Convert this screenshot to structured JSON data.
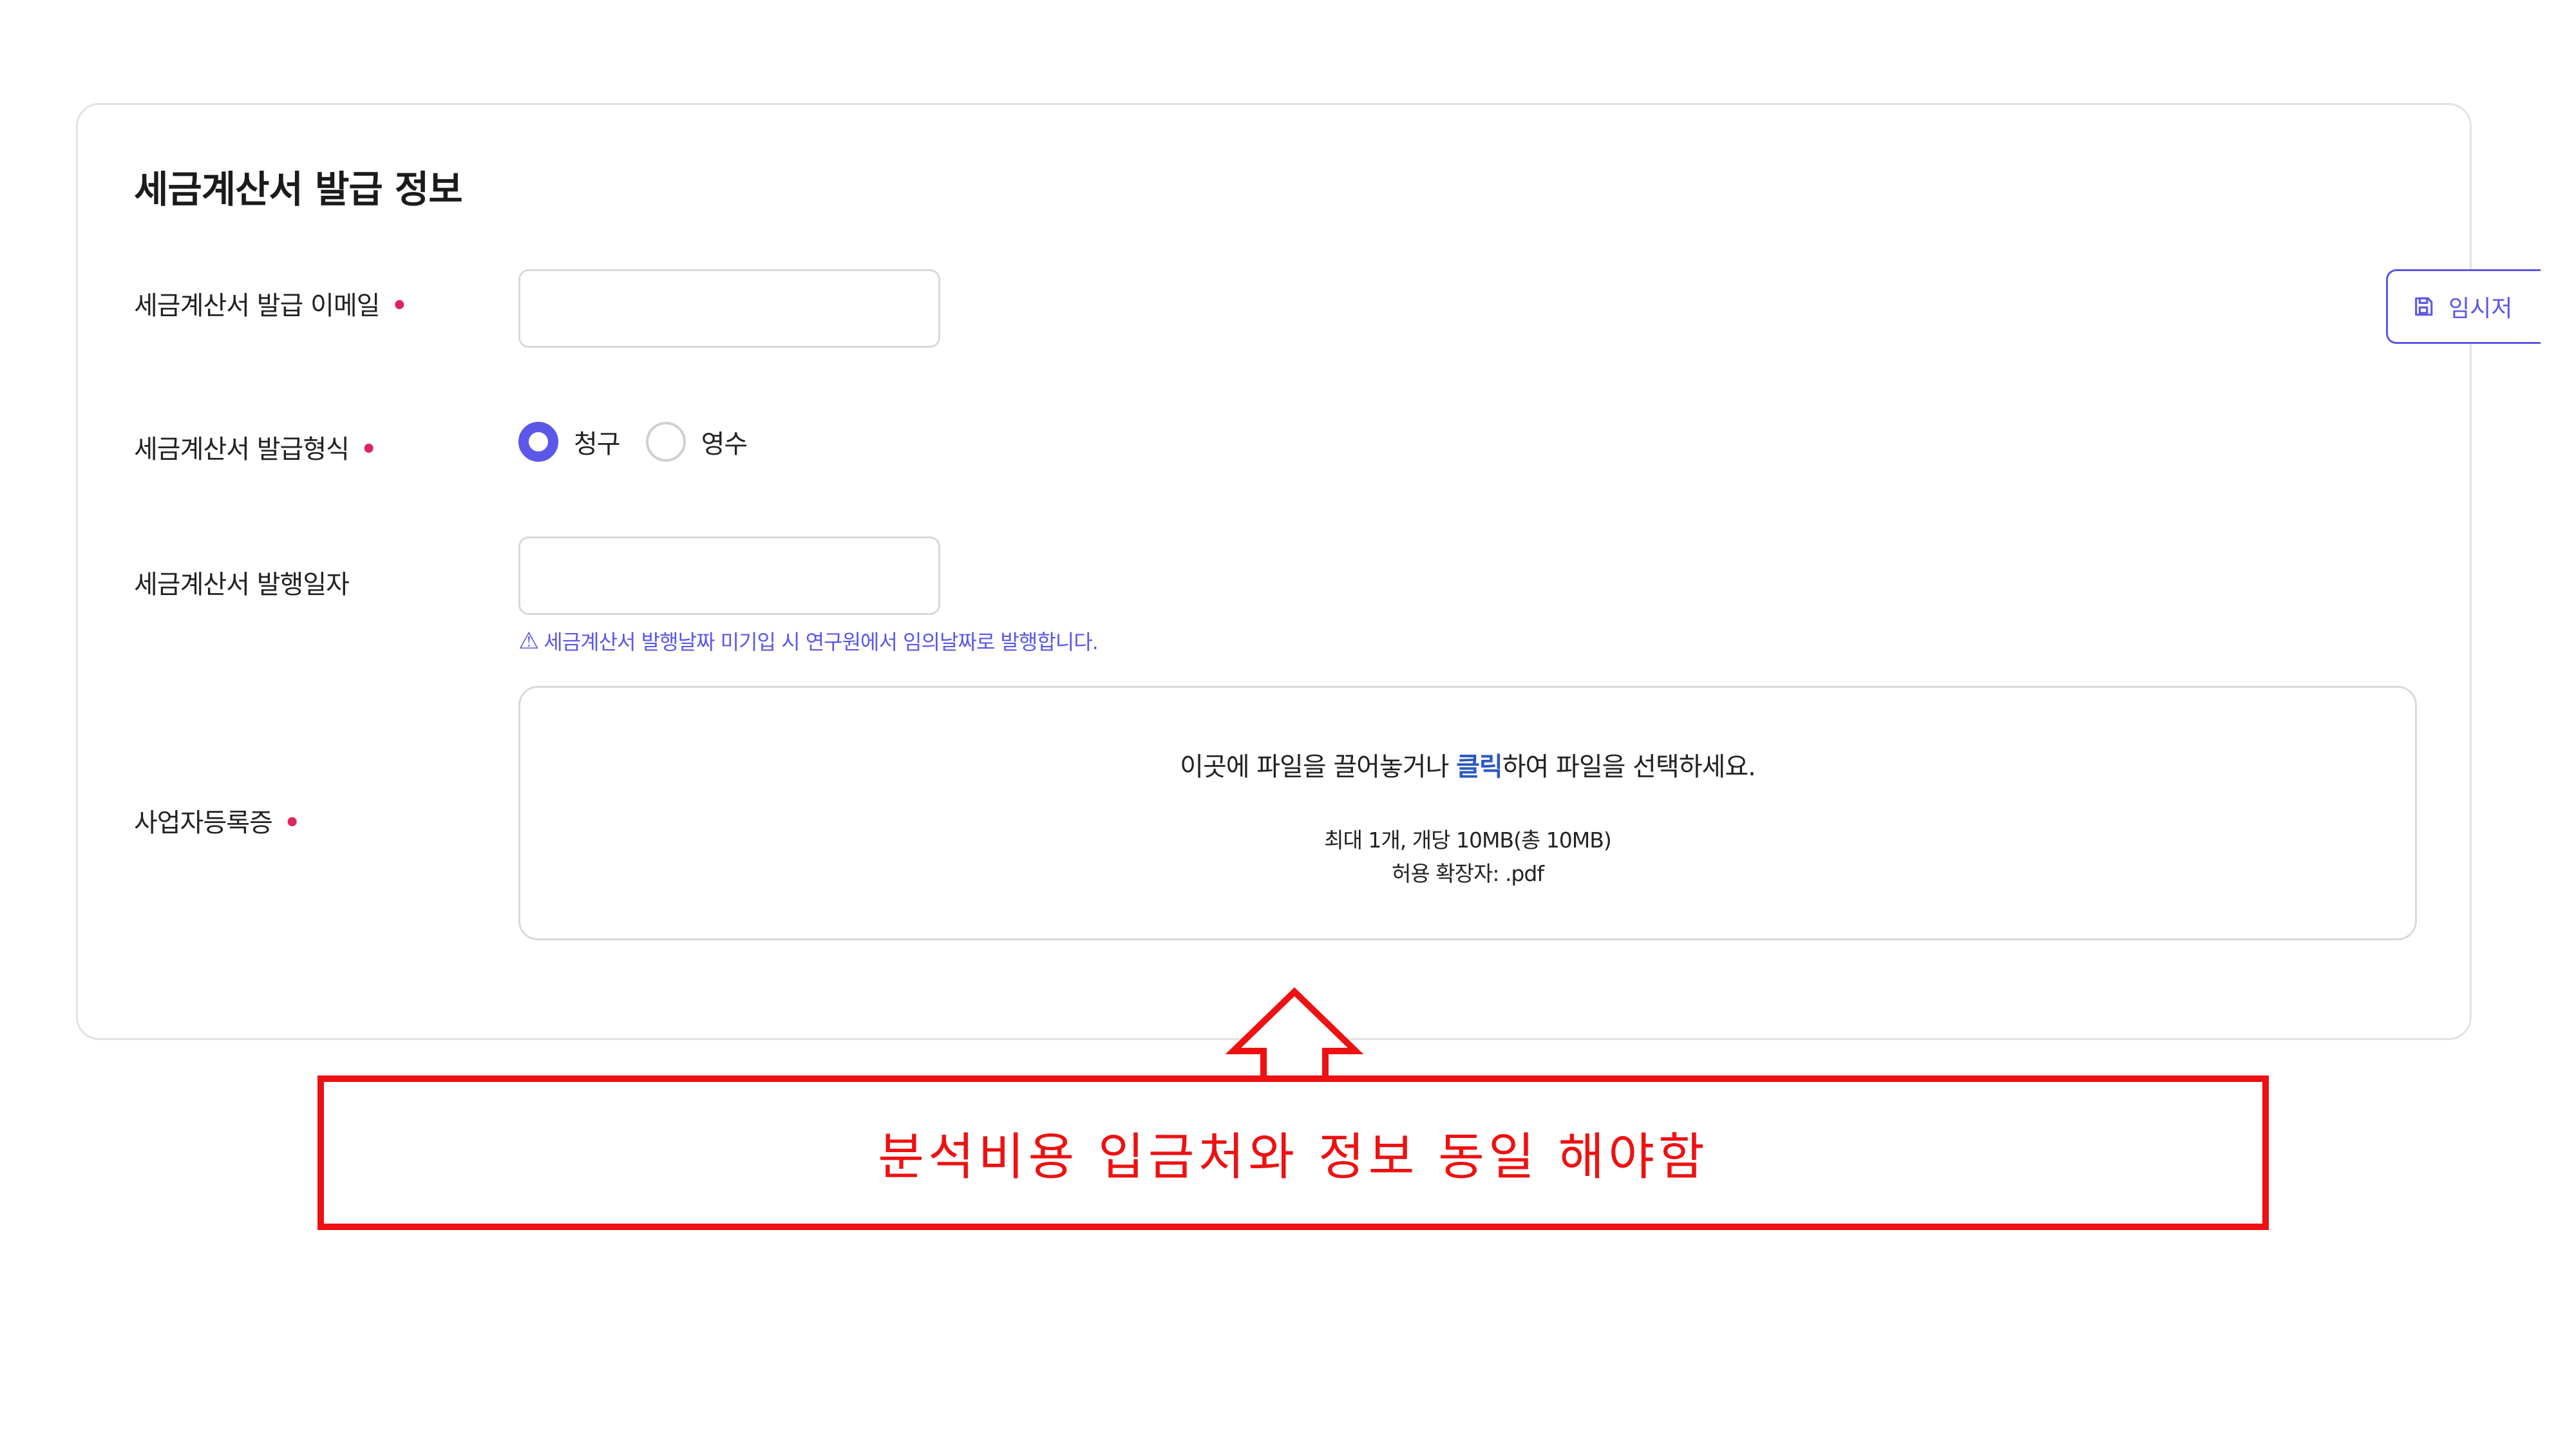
{
  "form": {
    "section_title": "세금계산서 발급 정보",
    "required_marker": "•",
    "email": {
      "label": "세금계산서 발급 이메일",
      "value": ""
    },
    "issue_type": {
      "label": "세금계산서 발급형식",
      "options": [
        {
          "label": "청구",
          "selected": true
        },
        {
          "label": "영수",
          "selected": false
        }
      ]
    },
    "issue_date": {
      "label": "세금계산서 발행일자",
      "value": "",
      "warning": "세금계산서 발행날짜 미기입 시 연구원에서 임의날짜로 발행합니다.",
      "warning_icon": "warning-triangle-icon"
    },
    "business_registration": {
      "label": "사업자등록증",
      "dropzone": {
        "text_before": "이곳에 파일을 끌어놓거나 ",
        "click_text": "클릭",
        "text_after": "하여 파일을 선택하세요.",
        "limit_text": "최대 1개, 개당 10MB(총 10MB)",
        "extensions_text": "허용 확장자: .pdf"
      }
    }
  },
  "temp_save_button": {
    "label": "임시저",
    "icon": "save-icon"
  },
  "annotation": {
    "text": "분석비용 입금처와 정보 동일 해야함",
    "color": "#ee1111"
  },
  "colors": {
    "accent": "#5b57e8",
    "required": "#e0245e",
    "link": "#2b59c3"
  }
}
